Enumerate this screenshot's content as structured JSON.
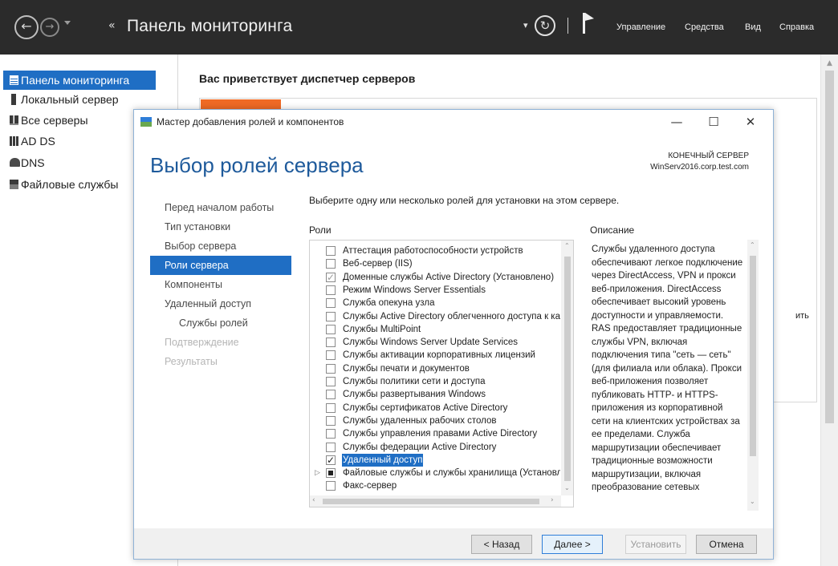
{
  "server_manager": {
    "title": "Панель мониторинга",
    "breadcrumb_arrows": "«",
    "menu": [
      "Управление",
      "Средства",
      "Вид",
      "Справка"
    ],
    "nav": [
      {
        "label": "Панель мониторинга",
        "icon": "dashboard-icon",
        "active": true
      },
      {
        "label": "Локальный сервер",
        "icon": "server-icon",
        "active": false
      },
      {
        "label": "Все серверы",
        "icon": "servers-icon",
        "active": false
      },
      {
        "label": "AD DS",
        "icon": "ad-ds-icon",
        "active": false
      },
      {
        "label": "DNS",
        "icon": "dns-icon",
        "active": false
      },
      {
        "label": "Файловые службы",
        "icon": "file-services-icon",
        "active": false
      }
    ],
    "welcome": "Вас приветствует диспетчер серверов",
    "partial_text": "ить"
  },
  "wizard": {
    "title": "Мастер добавления ролей и компонентов",
    "heading": "Выбор ролей сервера",
    "destination_label": "КОНЕЧНЫЙ СЕРВЕР",
    "destination_server": "WinServ2016.corp.test.com",
    "steps": [
      {
        "label": "Перед началом работы",
        "state": "normal"
      },
      {
        "label": "Тип установки",
        "state": "normal"
      },
      {
        "label": "Выбор сервера",
        "state": "normal"
      },
      {
        "label": "Роли сервера",
        "state": "active"
      },
      {
        "label": "Компоненты",
        "state": "normal"
      },
      {
        "label": "Удаленный доступ",
        "state": "normal"
      },
      {
        "label": "Службы ролей",
        "state": "sub"
      },
      {
        "label": "Подтверждение",
        "state": "disabled"
      },
      {
        "label": "Результаты",
        "state": "disabled"
      }
    ],
    "instruction": "Выберите одну или несколько ролей для установки на этом сервере.",
    "roles_header": "Роли",
    "description_header": "Описание",
    "roles": [
      {
        "label": "Аттестация работоспособности устройств",
        "state": "unchecked"
      },
      {
        "label": "Веб-сервер (IIS)",
        "state": "unchecked"
      },
      {
        "label": "Доменные службы Active Directory (Установлено)",
        "state": "installed"
      },
      {
        "label": "Режим Windows Server Essentials",
        "state": "unchecked"
      },
      {
        "label": "Служба опекуна узла",
        "state": "unchecked"
      },
      {
        "label": "Службы Active Directory облегченного доступа к каталогам",
        "state": "unchecked"
      },
      {
        "label": "Службы MultiPoint",
        "state": "unchecked"
      },
      {
        "label": "Службы Windows Server Update Services",
        "state": "unchecked"
      },
      {
        "label": "Службы активации корпоративных лицензий",
        "state": "unchecked"
      },
      {
        "label": "Службы печати и документов",
        "state": "unchecked"
      },
      {
        "label": "Службы политики сети и доступа",
        "state": "unchecked"
      },
      {
        "label": "Службы развертывания Windows",
        "state": "unchecked"
      },
      {
        "label": "Службы сертификатов Active Directory",
        "state": "unchecked"
      },
      {
        "label": "Службы удаленных рабочих столов",
        "state": "unchecked"
      },
      {
        "label": "Службы управления правами Active Directory",
        "state": "unchecked"
      },
      {
        "label": "Службы федерации Active Directory",
        "state": "unchecked"
      },
      {
        "label": "Удаленный доступ",
        "state": "checked",
        "selected": true
      },
      {
        "label": "Файловые службы и службы хранилища (Установлено)",
        "state": "partial",
        "expandable": true
      },
      {
        "label": "Факс-сервер",
        "state": "unchecked"
      }
    ],
    "description": "Службы удаленного доступа обеспечивают легкое подключение через DirectAccess, VPN и прокси веб-приложения. DirectAccess обеспечивает высокий уровень доступности и управляемости. RAS предоставляет традиционные службы VPN, включая подключения типа \"сеть — сеть\" (для филиала или облака). Прокси веб-приложения позволяет публиковать HTTP- и HTTPS-приложения из корпоративной сети на клиентских устройствах за ее пределами. Служба маршрутизации обеспечивает традиционные возможности маршрутизации, включая преобразование сетевых",
    "buttons": {
      "back": "< Назад",
      "next": "Далее >",
      "install": "Установить",
      "cancel": "Отмена"
    }
  },
  "colors": {
    "titlebar_bg": "#2b2b2b",
    "accent_blue": "#1f6ec4",
    "heading_blue": "#1e5a9b",
    "tile_orange": "#ef6a25"
  }
}
